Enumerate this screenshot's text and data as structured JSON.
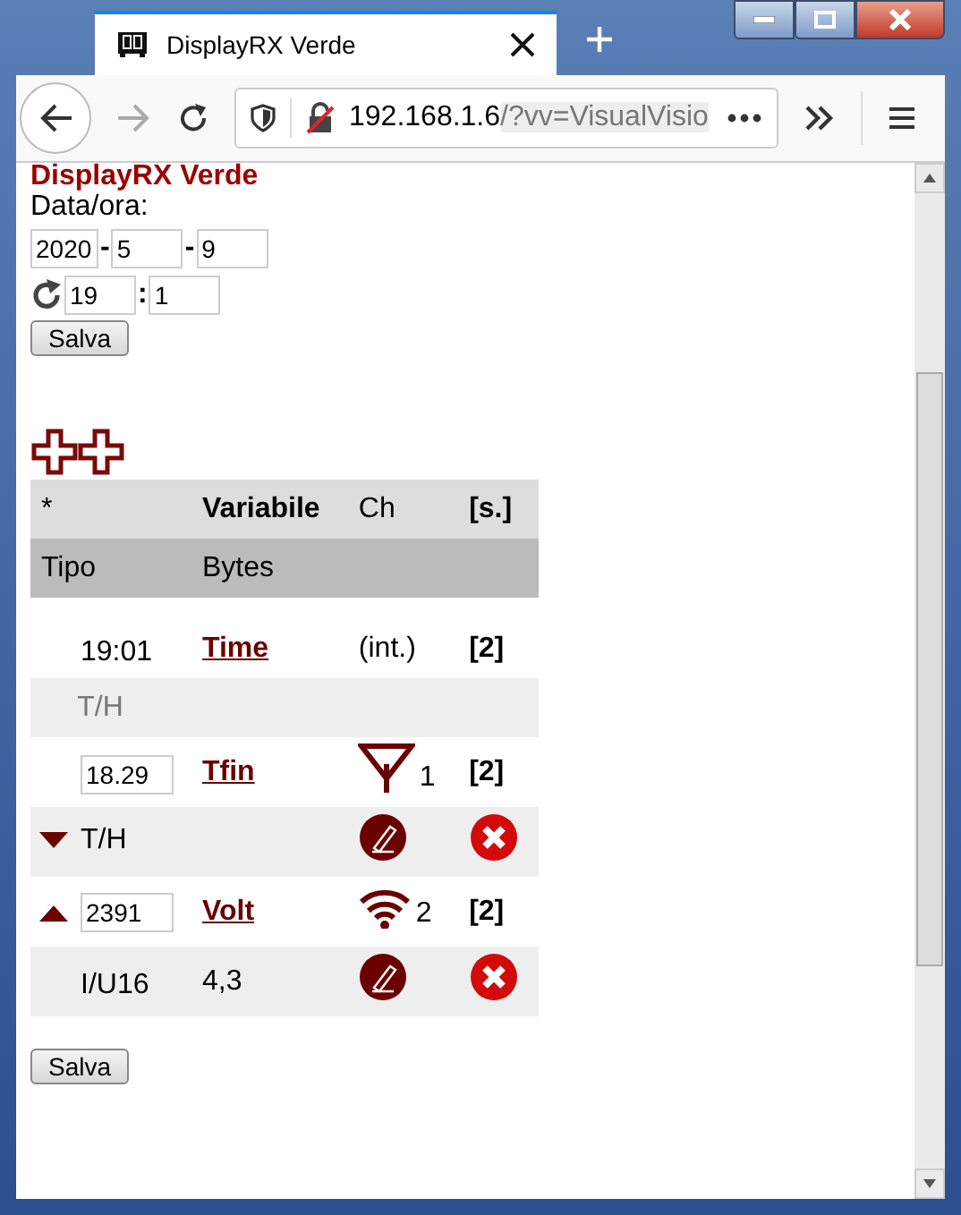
{
  "browser": {
    "tab_title": "DisplayRX Verde",
    "url_host": "192.168.1.6",
    "url_rest": "/?vv=VisualVisio"
  },
  "page": {
    "heading": "DisplayRX Verde",
    "date_label": "Data/ora:",
    "year": "2020",
    "sep1": "-",
    "month": "5",
    "sep2": "-",
    "day": "9",
    "hour": "19",
    "time_sep": ":",
    "minute": "1",
    "save": "Salva"
  },
  "table": {
    "header1": [
      "*",
      "Variabile",
      "Ch",
      "[s.]"
    ],
    "header2": [
      "Tipo",
      "Bytes"
    ],
    "rows": [
      {
        "value": {
          "kind": "text",
          "text": "19:01"
        },
        "name": "Time",
        "channel": {
          "kind": "internal",
          "text": "(int.)"
        },
        "seconds": "[2]",
        "move_up": false,
        "move_down": false,
        "type": "T/H",
        "editable": false
      },
      {
        "value": {
          "kind": "input",
          "text": "18.29"
        },
        "name": "Tfin",
        "channel": {
          "kind": "radio",
          "text": "1"
        },
        "seconds": "[2]",
        "move_up": false,
        "move_down": true,
        "type": "T/H",
        "editable": true
      },
      {
        "value": {
          "kind": "input",
          "text": "2391"
        },
        "name": "Volt",
        "channel": {
          "kind": "wifi",
          "text": "2"
        },
        "seconds": "[2]",
        "move_up": true,
        "move_down": false,
        "type": "I/U16",
        "bytes": "4,3",
        "editable": true
      }
    ]
  },
  "save_bottom": "Salva"
}
